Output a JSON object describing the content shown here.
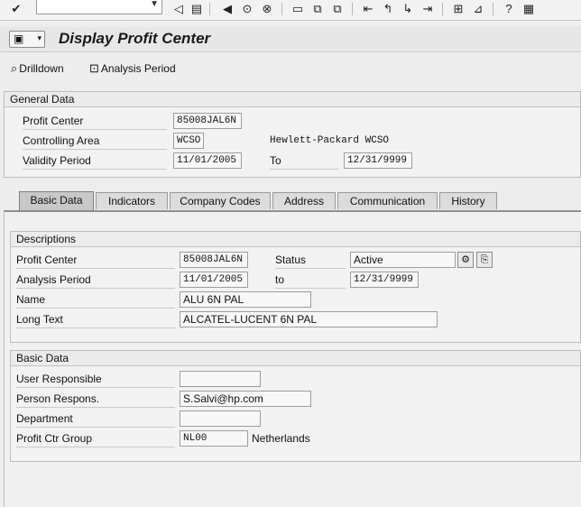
{
  "toolbar": {
    "icons": [
      "enter-icon",
      "command-dropdown-icon",
      "back-arrow-icon",
      "save-icon",
      "back-icon",
      "exit-icon",
      "cancel-icon",
      "print-icon",
      "find-icon",
      "find-next-icon",
      "first-page-icon",
      "previous-page-icon",
      "next-page-icon",
      "last-page-icon",
      "new-session-icon",
      "shortcut-icon",
      "help-icon",
      "layout-icon"
    ]
  },
  "title": "Display Profit Center",
  "app_toolbar": {
    "drilldown": "Drilldown",
    "analysis_period": "Analysis Period"
  },
  "general_data": {
    "header": "General Data",
    "profit_center_label": "Profit Center",
    "profit_center_value": "85008JAL6N",
    "controlling_area_label": "Controlling Area",
    "controlling_area_value": "WCSO",
    "controlling_area_desc": "Hewlett-Packard WCSO",
    "validity_label": "Validity Period",
    "validity_from": "11/01/2005",
    "to_label": "To",
    "validity_to": "12/31/9999"
  },
  "tabs": [
    "Basic Data",
    "Indicators",
    "Company Codes",
    "Address",
    "Communication",
    "History"
  ],
  "descriptions": {
    "header": "Descriptions",
    "profit_center_label": "Profit Center",
    "profit_center_value": "85008JAL6N",
    "status_label": "Status",
    "status_value": "Active",
    "analysis_label": "Analysis Period",
    "analysis_from": "11/01/2005",
    "to_label": "to",
    "analysis_to": "12/31/9999",
    "name_label": "Name",
    "name_value": "ALU 6N PAL",
    "long_text_label": "Long Text",
    "long_text_value": "ALCATEL-LUCENT  6N PAL"
  },
  "basic_data": {
    "header": "Basic Data",
    "user_resp_label": "User Responsible",
    "user_resp_value": "",
    "person_resp_label": "Person Respons.",
    "person_resp_value": "S.Salvi@hp.com",
    "department_label": "Department",
    "department_value": "",
    "group_label": "Profit Ctr Group",
    "group_value": "NL00",
    "group_desc": "Netherlands"
  }
}
